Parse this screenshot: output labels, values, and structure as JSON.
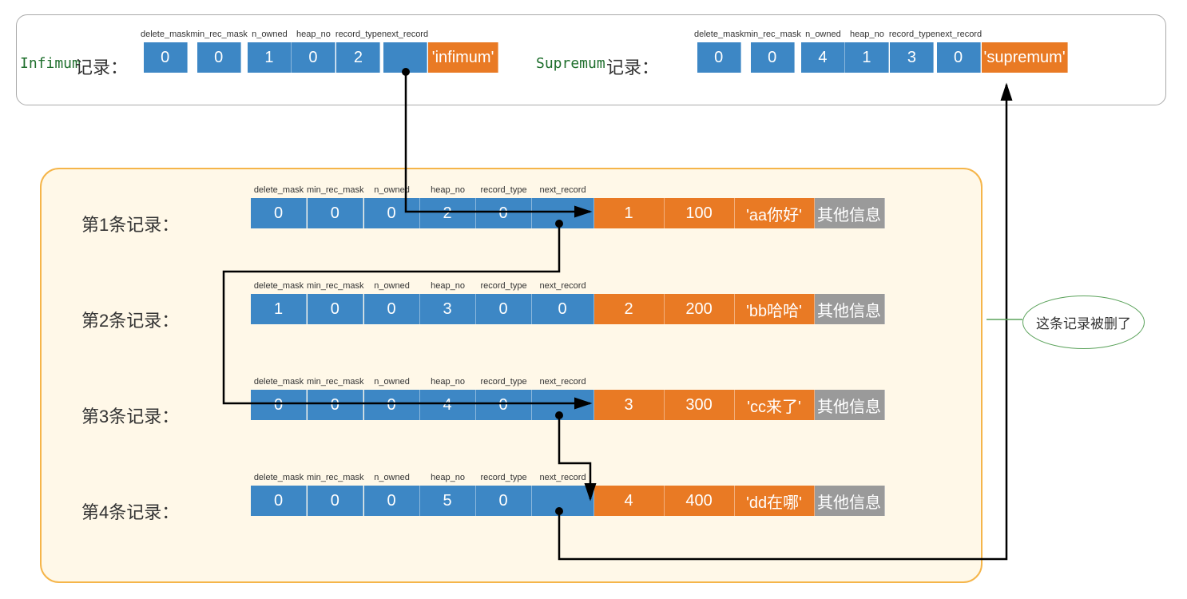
{
  "headers": {
    "delete_mask": "delete_mask",
    "min_rec_mask": "min_rec_mask",
    "n_owned": "n_owned",
    "heap_no": "heap_no",
    "record_type": "record_type",
    "next_record": "next_record"
  },
  "top": {
    "infimum_label_code": "Infimum",
    "infimum_label_text": "记录：",
    "supremum_label_code": "Supremum",
    "supremum_label_text": "记录：",
    "infimum": {
      "delete_mask": "0",
      "min_rec_mask": "0",
      "n_owned": "1",
      "heap_no": "0",
      "record_type": "2",
      "next_record": "",
      "text": "'infimum'"
    },
    "supremum": {
      "delete_mask": "0",
      "min_rec_mask": "0",
      "n_owned": "4",
      "heap_no": "1",
      "record_type": "3",
      "next_record": "0",
      "text": "'supremum'"
    }
  },
  "records": [
    {
      "label": "第1条记录：",
      "delete_mask": "0",
      "min_rec_mask": "0",
      "n_owned": "0",
      "heap_no": "2",
      "record_type": "0",
      "next_record": "",
      "col1": "1",
      "col2": "100",
      "col3": "'aa你好'",
      "extra": "其他信息"
    },
    {
      "label": "第2条记录：",
      "delete_mask": "1",
      "min_rec_mask": "0",
      "n_owned": "0",
      "heap_no": "3",
      "record_type": "0",
      "next_record": "0",
      "col1": "2",
      "col2": "200",
      "col3": "'bb哈哈'",
      "extra": "其他信息"
    },
    {
      "label": "第3条记录：",
      "delete_mask": "0",
      "min_rec_mask": "0",
      "n_owned": "0",
      "heap_no": "4",
      "record_type": "0",
      "next_record": "",
      "col1": "3",
      "col2": "300",
      "col3": "'cc来了'",
      "extra": "其他信息"
    },
    {
      "label": "第4条记录：",
      "delete_mask": "0",
      "min_rec_mask": "0",
      "n_owned": "0",
      "heap_no": "5",
      "record_type": "0",
      "next_record": "",
      "col1": "4",
      "col2": "400",
      "col3": "'dd在哪'",
      "extra": "其他信息"
    }
  ],
  "callout": "这条记录被删了"
}
